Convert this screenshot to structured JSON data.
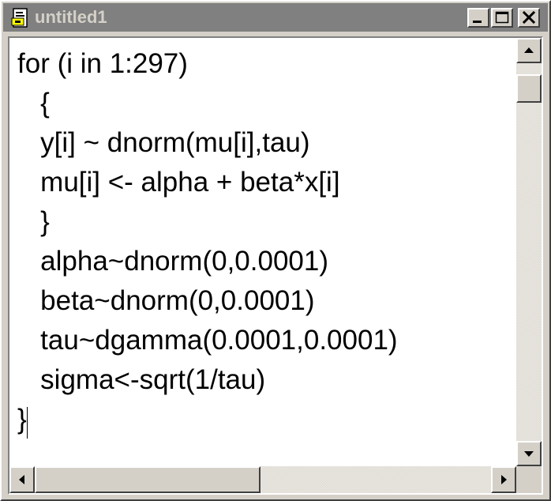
{
  "window": {
    "title": "untitled1",
    "icon": "document-icon"
  },
  "caption_buttons": {
    "minimize_icon": "minimize-icon",
    "maximize_icon": "maximize-icon",
    "close_icon": "close-icon"
  },
  "editor": {
    "lines": [
      "for (i in 1:297)",
      "   {",
      "   y[i] ~ dnorm(mu[i],tau)",
      "   mu[i] <- alpha + beta*x[i]",
      "   }",
      "   alpha~dnorm(0,0.0001)",
      "   beta~dnorm(0,0.0001)",
      "   tau~dgamma(0.0001,0.0001)",
      "   sigma<-sqrt(1/tau)",
      "}"
    ]
  },
  "colors": {
    "title_bar_inactive": "#808080",
    "title_text_inactive": "#d4d0c8",
    "face": "#d4d0c8",
    "text_background": "#ffffff"
  }
}
